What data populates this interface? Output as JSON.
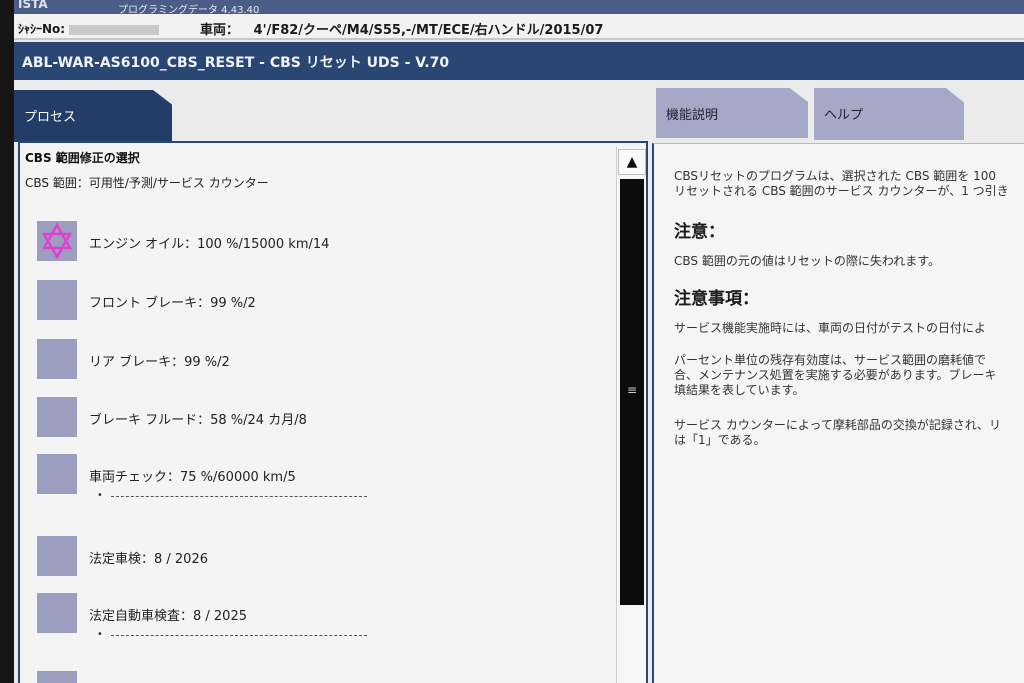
{
  "header": {
    "logo": "ISTA",
    "programming_data": "プログラミングデータ  4.43.40",
    "chassis_label": "ｼｬｼｰNo:",
    "chassis_value": "        ",
    "vehicle_label": "車両：",
    "vehicle_value": "4'/F82/クーペ/M4/S55,-/MT/ECE/右ハンドル/2015/07"
  },
  "title": "ABL-WAR-AS6100_CBS_RESET - CBS リセット UDS - V.70",
  "tabs": {
    "process": "プロセス",
    "function": "機能説明",
    "help": "ヘルプ"
  },
  "left": {
    "heading": "CBS 範囲修正の選択",
    "subheading": "CBS 範囲：可用性/予測/サービス カウンター",
    "items": [
      {
        "label": "エンジン オイル：100 %/15000 km/14",
        "selected": true
      },
      {
        "label": "フロント ブレーキ：99 %/2",
        "selected": false
      },
      {
        "label": "リア ブレーキ：99 %/2",
        "selected": false
      },
      {
        "label": "ブレーキ フルード：58 %/24 カ月/8",
        "selected": false
      },
      {
        "label": "車両チェック：75 %/60000 km/5",
        "selected": false
      },
      {
        "label": "法定車検：8 / 2026",
        "selected": false
      },
      {
        "label": "法定自動車検査：8 / 2025",
        "selected": false
      }
    ],
    "bullet": "•"
  },
  "scrollbar": {
    "up": "▲",
    "grip": "≡"
  },
  "right": {
    "line1": "CBSリセットのプログラムは、選択された CBS 範囲を 100",
    "line2": "リセットされる CBS 範囲のサービス カウンターが、1 つ引き",
    "h_caution": "注意：",
    "caution_text": "CBS 範囲の元の値はリセットの際に失われます。",
    "h_notes": "注意事項：",
    "notes_1": "サービス機能実施時には、車両の日付がテストの日付によ",
    "notes_2a": "パーセント単位の残存有効度は、サービス範囲の磨耗値で",
    "notes_2b": "合、メンテナンス処置を実施する必要があります。ブレーキ",
    "notes_2c": "填結果を表しています。",
    "notes_3a": "サービス カウンターによって摩耗部品の交換が記録され、リ",
    "notes_3b": "は「1」である。"
  },
  "colors": {
    "accent": "#2a4673",
    "item_box": "#9c9ec0",
    "selected_star": "#e040d0"
  },
  "icons": {
    "selected": "star-of-david-icon"
  }
}
